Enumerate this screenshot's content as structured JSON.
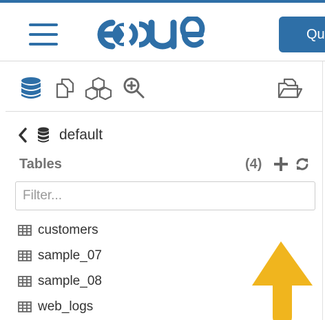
{
  "header": {
    "logo_text": "HUE",
    "query_button_label": "Qu"
  },
  "assist": {
    "toolbar": {
      "icons": [
        "database-icon",
        "documents-icon",
        "cubes-icon",
        "zoom-search-icon",
        "folder-open-icon"
      ]
    },
    "breadcrumb": {
      "label": "default"
    },
    "tables": {
      "title": "Tables",
      "count": "(4)"
    },
    "filter": {
      "placeholder": "Filter...",
      "value": ""
    },
    "table_names": [
      "customers",
      "sample_07",
      "sample_08",
      "web_logs"
    ]
  },
  "colors": {
    "brand_blue": "#2e6fa7",
    "annotation_arrow": "#f0b51e"
  }
}
